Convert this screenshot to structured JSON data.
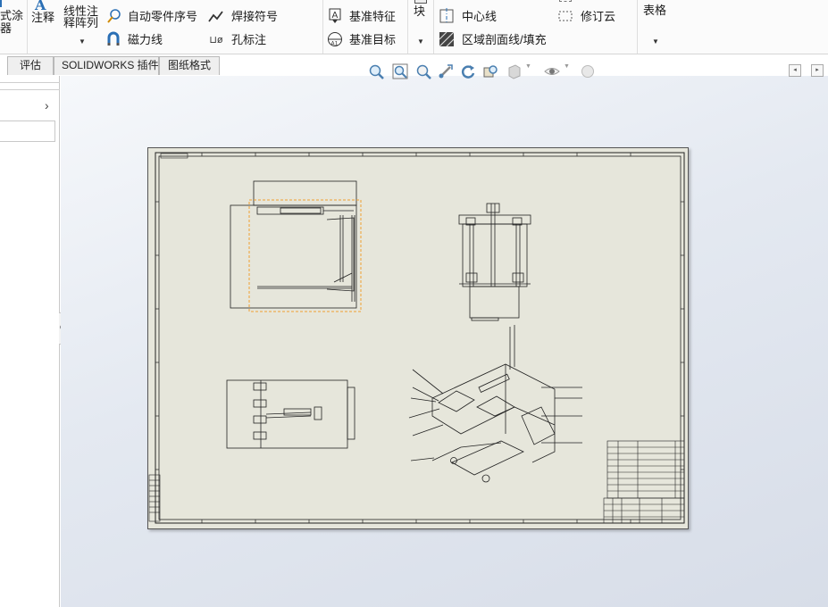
{
  "ribbon": {
    "partial_left_label_line1": "式涂",
    "partial_left_label_line2": "器",
    "note_label": "注释",
    "linear_note_line1": "线性注",
    "linear_note_line2": "释阵列",
    "auto_balloon": "自动零件序号",
    "magnetic_line": "磁力线",
    "weld_symbol": "焊接符号",
    "hole_callout": "孔标注",
    "datum_feature": "基准特征",
    "datum_target": "基准目标",
    "block_label": "块",
    "centerline": "中心线",
    "area_hatch": "区域剖面线/填充",
    "revision_cloud": "修订云",
    "table_label": "表格"
  },
  "tabs": [
    {
      "label": "评估"
    },
    {
      "label": "SOLIDWORKS 插件"
    },
    {
      "label": "图纸格式"
    }
  ],
  "colors": {
    "sheet": "#e6e6db",
    "selection": "#f0a030",
    "accent_blue": "#2a6fb5"
  },
  "icons": {
    "view_toolbar": [
      "zoom-to-fit-icon",
      "zoom-area-icon",
      "zoom-in-out-icon",
      "pan-icon",
      "rotate-icon",
      "previous-view-icon",
      "display-style-icon",
      "hide-show-icon",
      "appearance-icon"
    ]
  }
}
